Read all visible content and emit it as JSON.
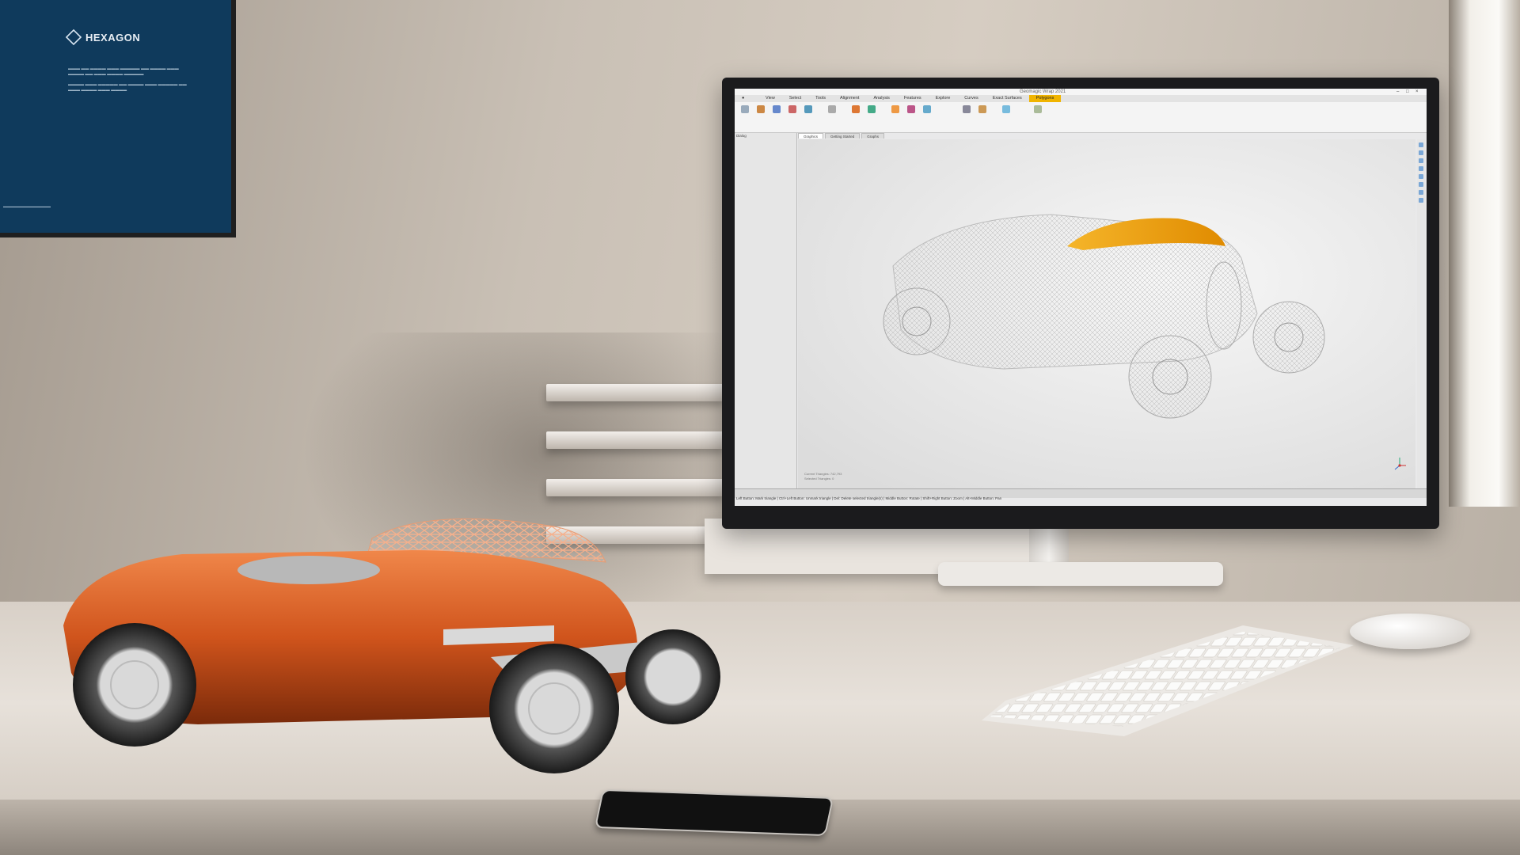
{
  "poster": {
    "brand": "HEXAGON"
  },
  "app": {
    "title": "Geomagic Wrap 2021",
    "menu": [
      "View",
      "Select",
      "Tools",
      "Alignment",
      "Analysis",
      "Features",
      "Explore",
      "Curves",
      "Exact Surfaces",
      "Polygons"
    ],
    "active_menu": "Polygons",
    "document_tabs": [
      "Graphics",
      "Getting Started",
      "Graphs"
    ],
    "left_panel_title": "Dialog",
    "statusbar": "Left Button: Mark triangle | Ctrl+Left Button: Unmark triangle | Del: Delete selected triangle(s) | Middle Button: Rotate | Shift+Right Button: Zoom | Alt+Middle Button: Pan",
    "viewport_info": [
      "Current Triangles: 742,793",
      "Selected Triangles: 0"
    ]
  },
  "colors": {
    "poster_bg": "#0f3a5c",
    "highlight": "#f0a500",
    "model_car_body": "#d0541c"
  },
  "icons": [
    "hexagon-logo-icon",
    "axis-triad-icon"
  ]
}
